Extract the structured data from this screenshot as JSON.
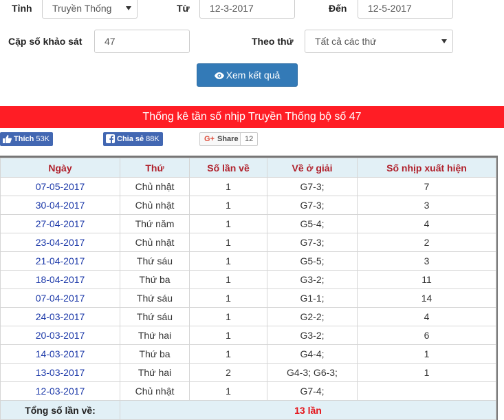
{
  "filters": {
    "province_label": "Tỉnh",
    "province_value": "Truyền Thống",
    "from_label": "Từ",
    "from_value": "12-3-2017",
    "to_label": "Đến",
    "to_value": "12-5-2017",
    "pair_label": "Cặp số khảo sát",
    "pair_value": "47",
    "weekday_label": "Theo thứ",
    "weekday_value": "Tất cả các thứ",
    "view_button": "Xem kết quả"
  },
  "banner": "Thống kê tần số nhịp Truyền Thống bộ số 47",
  "social": {
    "like_label": "Thích",
    "like_count": "53K",
    "share_label": "Chia sẻ",
    "share_count": "88K",
    "gplus_label": "Share",
    "gplus_count": "12"
  },
  "table": {
    "headers": [
      "Ngày",
      "Thứ",
      "Số lần về",
      "Về ở giải",
      "Số nhịp xuất hiện"
    ],
    "rows": [
      [
        "07-05-2017",
        "Chủ nhật",
        "1",
        "G7-3;",
        "7"
      ],
      [
        "30-04-2017",
        "Chủ nhật",
        "1",
        "G7-3;",
        "3"
      ],
      [
        "27-04-2017",
        "Thứ năm",
        "1",
        "G5-4;",
        "4"
      ],
      [
        "23-04-2017",
        "Chủ nhật",
        "1",
        "G7-3;",
        "2"
      ],
      [
        "21-04-2017",
        "Thứ sáu",
        "1",
        "G5-5;",
        "3"
      ],
      [
        "18-04-2017",
        "Thứ ba",
        "1",
        "G3-2;",
        "11"
      ],
      [
        "07-04-2017",
        "Thứ sáu",
        "1",
        "G1-1;",
        "14"
      ],
      [
        "24-03-2017",
        "Thứ sáu",
        "1",
        "G2-2;",
        "4"
      ],
      [
        "20-03-2017",
        "Thứ hai",
        "1",
        "G3-2;",
        "6"
      ],
      [
        "14-03-2017",
        "Thứ ba",
        "1",
        "G4-4;",
        "1"
      ],
      [
        "13-03-2017",
        "Thứ hai",
        "2",
        "G4-3; G6-3;",
        "1"
      ],
      [
        "12-03-2017",
        "Chủ nhật",
        "1",
        "G7-4;",
        ""
      ]
    ],
    "total_label": "Tổng số lần về:",
    "total_value": "13 lần"
  },
  "colors": {
    "banner": "#ff1d25",
    "button": "#337ab7",
    "header_bg": "#e2f0f6",
    "header_text": "#b0202b",
    "date_link": "#1a37a8",
    "total_value": "#e4141a"
  }
}
